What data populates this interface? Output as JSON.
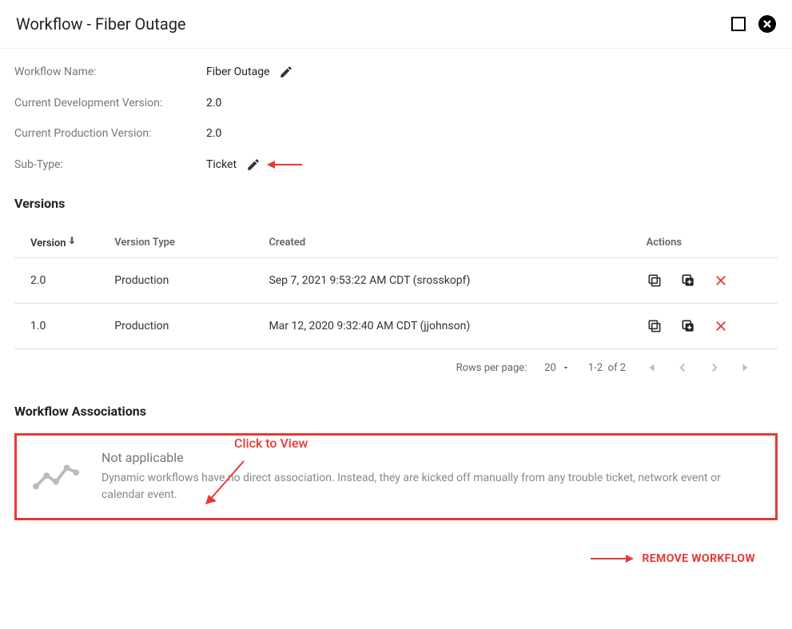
{
  "header": {
    "title": "Workflow - Fiber Outage"
  },
  "meta": {
    "name_label": "Workflow Name:",
    "name_value": "Fiber Outage",
    "dev_label": "Current Development Version:",
    "dev_value": "2.0",
    "prod_label": "Current Production Version:",
    "prod_value": "2.0",
    "subtype_label": "Sub-Type:",
    "subtype_value": "Ticket"
  },
  "versions": {
    "title": "Versions",
    "annotation": "Click to View",
    "columns": {
      "version": "Version",
      "type": "Version Type",
      "created": "Created",
      "actions": "Actions"
    },
    "rows": [
      {
        "version": "2.0",
        "type": "Production",
        "created": "Sep 7, 2021 9:53:22 AM CDT (srosskopf)"
      },
      {
        "version": "1.0",
        "type": "Production",
        "created": "Mar 12, 2020 9:32:40 AM CDT (jjohnson)"
      }
    ]
  },
  "pager": {
    "label": "Rows per page:",
    "perPage": "20",
    "range": "1-2",
    "ofLabel": "of 2"
  },
  "associations": {
    "title": "Workflow Associations",
    "na_title": "Not applicable",
    "na_body": "Dynamic workflows have no direct association. Instead, they are kicked off manually from any trouble ticket, network event or calendar event."
  },
  "footer": {
    "remove": "REMOVE WORKFLOW"
  }
}
